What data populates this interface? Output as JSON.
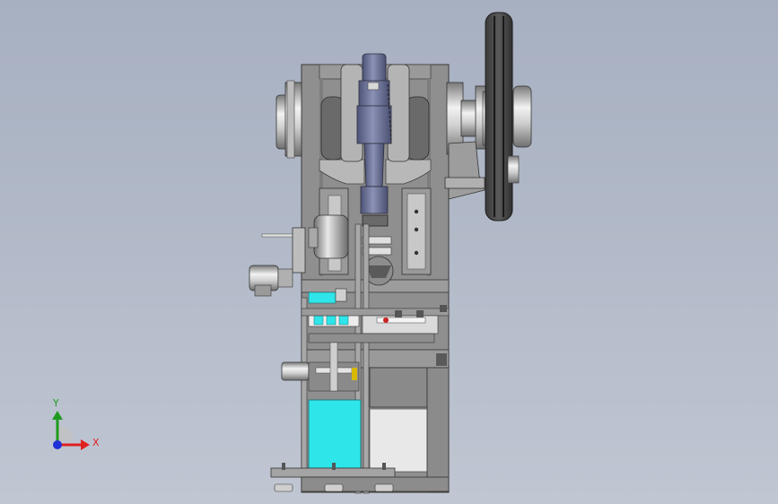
{
  "viewport": {
    "background_top": "#a7b0c1",
    "background_bottom": "#c0c6d2"
  },
  "model": {
    "frame_color": "#8f8f8f",
    "dark_color": "#3c3c3c",
    "steel_color": "#c8c8c8",
    "connecting_rod_color": "#6d7396",
    "highlight_color": "#2ee6ea"
  },
  "triad": {
    "x_label": "X",
    "y_label": "Y",
    "x_color": "#e02020",
    "y_color": "#1f9a1f",
    "z_color": "#2030d8",
    "icons": [
      "x-axis-arrow-icon",
      "y-axis-arrow-icon",
      "z-axis-origin-icon"
    ]
  }
}
